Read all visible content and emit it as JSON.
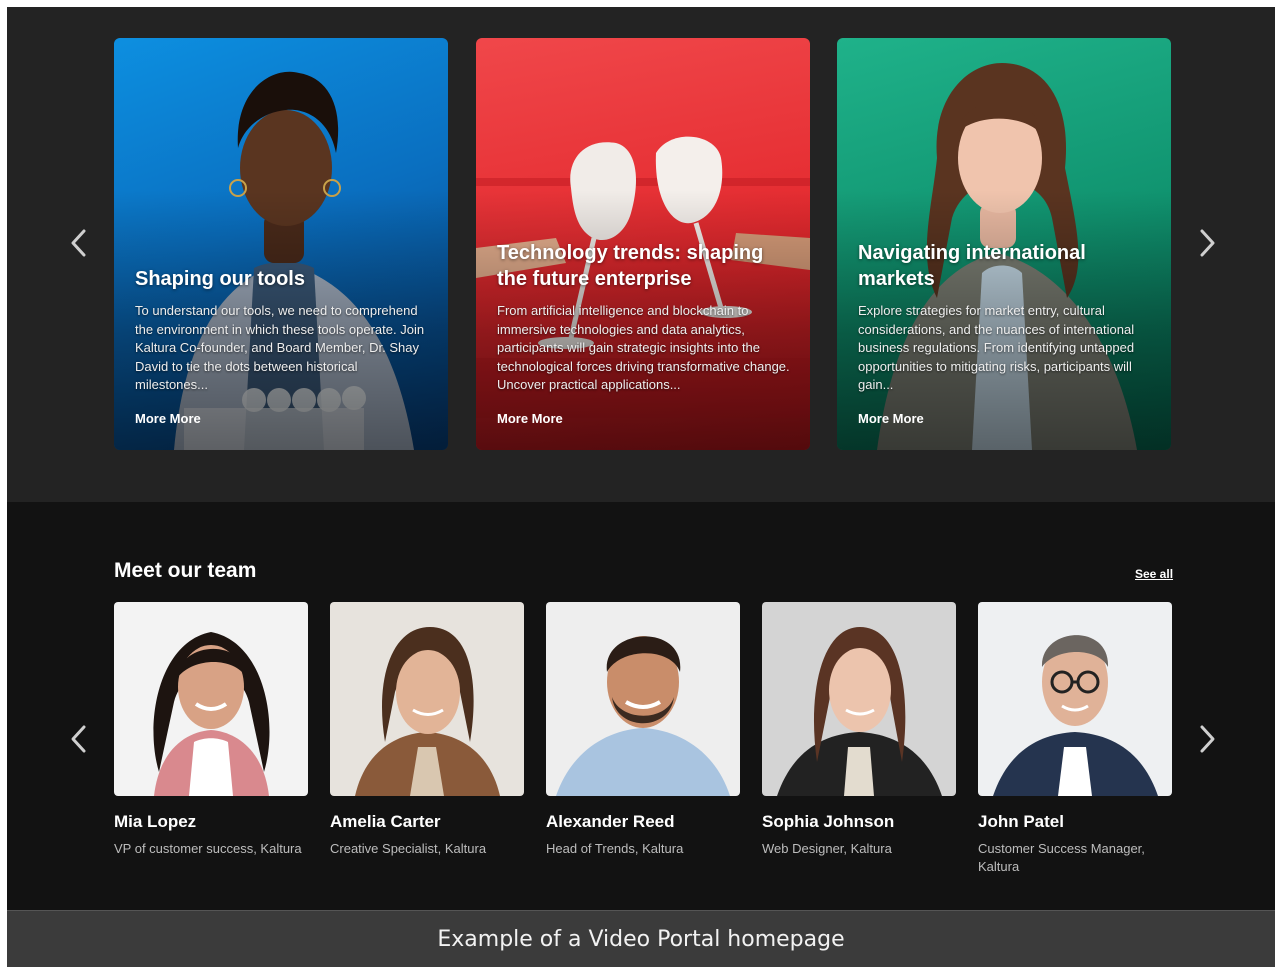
{
  "carousel": {
    "cards": [
      {
        "title": "Shaping our tools",
        "description": "To understand our tools, we need to comprehend the environment in which these tools operate. Join Kaltura Co-founder, and Board Member, Dr. Shay David to tie the dots between historical milestones...",
        "more_label": "More More",
        "accent": "#1e8fd6"
      },
      {
        "title": "Technology trends: shaping the future enterprise",
        "description": "From artificial intelligence and blockchain to immersive technologies and data analytics, participants will gain strategic insights into the technological forces driving transformative change. Uncover practical applications...",
        "more_label": "More More",
        "accent": "#e5333a"
      },
      {
        "title": "Navigating international markets",
        "description": "Explore strategies for market entry, cultural considerations, and the nuances of international business regulations. From identifying untapped opportunities to mitigating risks, participants will gain...",
        "more_label": "More More",
        "accent": "#16a07a"
      }
    ]
  },
  "team": {
    "title": "Meet our team",
    "see_all_label": "See all",
    "members": [
      {
        "name": "Mia Lopez",
        "role": "VP of customer success, Kaltura"
      },
      {
        "name": "Amelia Carter",
        "role": "Creative Specialist, Kaltura"
      },
      {
        "name": "Alexander Reed",
        "role": "Head of Trends, Kaltura"
      },
      {
        "name": "Sophia Johnson",
        "role": "Web Designer, Kaltura"
      },
      {
        "name": "John Patel",
        "role": "Customer Success Manager, Kaltura"
      }
    ]
  },
  "caption": "Example of a Video Portal homepage",
  "icons": [
    "chevron-left-icon",
    "chevron-right-icon"
  ]
}
